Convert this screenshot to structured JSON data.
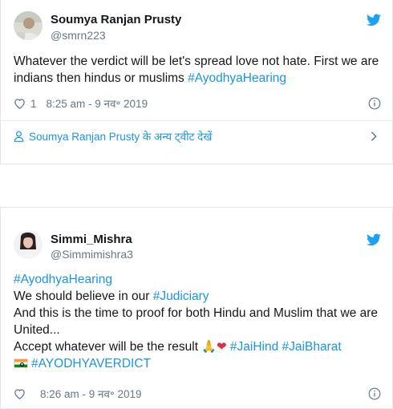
{
  "tweet1": {
    "author_name": "Soumya Ranjan Prusty",
    "author_handle": "@smrn223",
    "text_plain": "Whatever the verdict will be let's spread love not hate. First we are indians then hindus or muslims ",
    "hashtag": "#AyodhyaHearing",
    "like_count": "1",
    "timestamp": "8:25 am - 9 नव॰ 2019",
    "more_tweets_label": "Soumya Ranjan Prusty के अन्य ट्वीट देखें"
  },
  "tweet2": {
    "author_name": "Simmi_Mishra",
    "author_handle": "@Simmimishra3",
    "line1_hashtag": "#AyodhyaHearing",
    "line2_text": "We should believe in our ",
    "line2_hashtag": "#Judiciary",
    "line3_text": "And this is the time to proof for both Hindu and Muslim that we are United...",
    "line4_text": "Accept whatever will be the result ",
    "emoji_pray": "🙏",
    "emoji_heart": "❤",
    "hashtag_jaihind": "#JaiHind",
    "hashtag_jaibharat": "#JaiBharat",
    "hashtag_verdict": "#AYODHYAVERDICT",
    "timestamp": "8:26 am - 9 नव॰ 2019"
  },
  "icons": {
    "bird": "twitter-bird-icon",
    "heart": "heart-outline-icon",
    "info": "info-icon",
    "user": "user-outline-icon",
    "chevron": "chevron-right-icon",
    "flag": "india-flag-icon"
  },
  "colors": {
    "accent": "#1b95e0",
    "text": "#14171a",
    "secondary": "#657786",
    "border": "#e1e8ed"
  }
}
